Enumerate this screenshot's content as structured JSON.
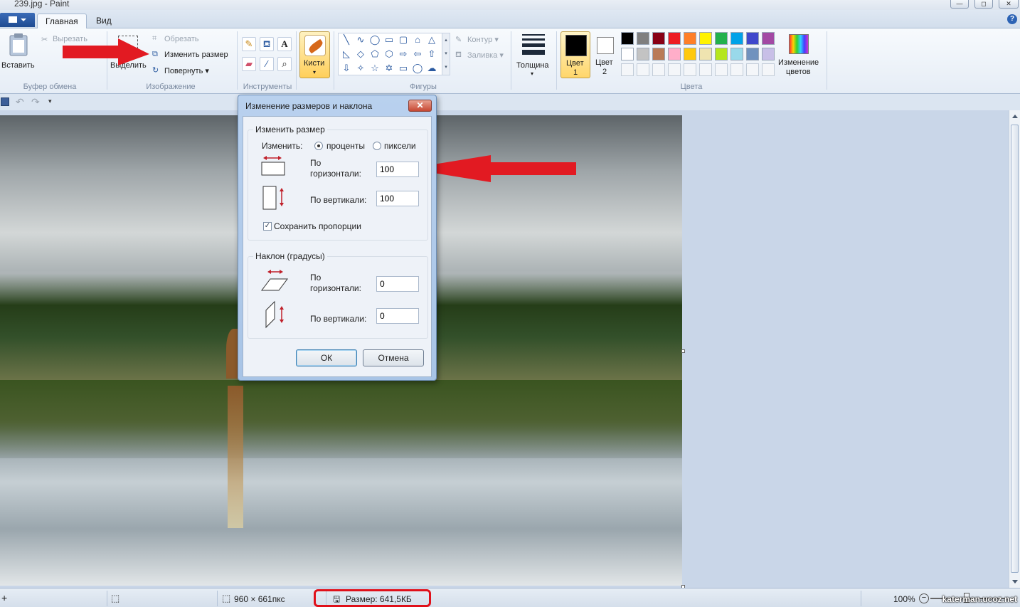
{
  "window": {
    "title": "239.jpg - Paint",
    "controls": [
      "—",
      "◻",
      "✕"
    ]
  },
  "tabs": [
    {
      "label": "Главная",
      "active": true
    },
    {
      "label": "Вид",
      "active": false
    }
  ],
  "help_icon": "?",
  "ribbon": {
    "clipboard": {
      "paste_label": "Вставить",
      "cut_label": "Вырезать",
      "group_label": "Буфер обмена"
    },
    "image": {
      "select_label": "Выделить",
      "crop_label": "Обрезать",
      "resize_label": "Изменить размер",
      "rotate_label": "Повернуть",
      "group_label": "Изображение"
    },
    "tools": {
      "group_label": "Инструменты",
      "text_tool_glyph": "A"
    },
    "brushes": {
      "label": "Кисти"
    },
    "shapes": {
      "outline_label": "Контур",
      "fill_label": "Заливка",
      "group_label": "Фигуры"
    },
    "size": {
      "label": "Толщина"
    },
    "colors": {
      "color1_label": "Цвет",
      "color1_number": "1",
      "color2_label": "Цвет",
      "color2_number": "2",
      "edit_colors_line1": "Изменение",
      "edit_colors_line2": "цветов",
      "group_label": "Цвета",
      "palette_row1": [
        "#000000",
        "#7f7f7f",
        "#880015",
        "#ed1c24",
        "#ff7f27",
        "#fff200",
        "#22b14c",
        "#00a2e8",
        "#3f48cc",
        "#a349a4"
      ],
      "palette_row2": [
        "#ffffff",
        "#c3c3c3",
        "#b97a57",
        "#ffaec9",
        "#ffc90e",
        "#efe4b0",
        "#b5e61d",
        "#99d9ea",
        "#7092be",
        "#c8bfe7"
      ],
      "palette_row3_empty": 10
    }
  },
  "dialog": {
    "title": "Изменение размеров и наклона",
    "resize": {
      "group_title": "Изменить размер",
      "by_label": "Изменить:",
      "option_percent": "проценты",
      "option_pixels": "пиксели",
      "selected": "percent",
      "horizontal_label_1": "По",
      "horizontal_label_2": "горизонтали:",
      "horizontal_value": "100",
      "vertical_label": "По вертикали:",
      "vertical_value": "100",
      "keep_ratio_label": "Сохранить пропорции",
      "keep_ratio_checked": true
    },
    "skew": {
      "group_title": "Наклон (градусы)",
      "horizontal_label_1": "По",
      "horizontal_label_2": "горизонтали:",
      "horizontal_value": "0",
      "vertical_label": "По вертикали:",
      "vertical_value": "0"
    },
    "ok_label": "ОК",
    "cancel_label": "Отмена"
  },
  "statusbar": {
    "image_dimensions": "960 × 661пкс",
    "file_size": "Размер: 641,5КБ",
    "zoom": "100%",
    "watermark": "katerman.ucoz.net"
  }
}
